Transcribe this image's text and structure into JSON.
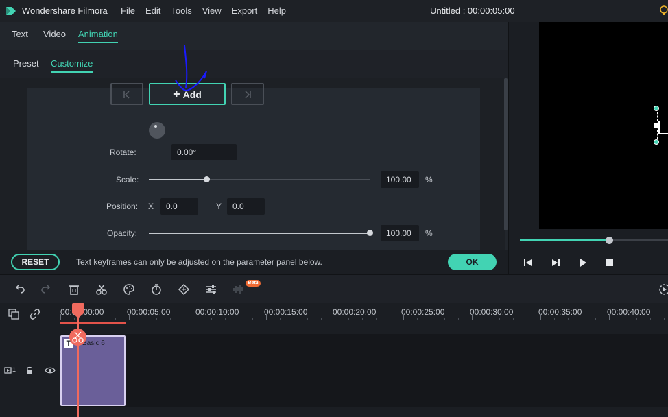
{
  "titlebar": {
    "app_name": "Wondershare Filmora",
    "menu": [
      "File",
      "Edit",
      "Tools",
      "View",
      "Export",
      "Help"
    ],
    "doc_title": "Untitled : 00:00:05:00"
  },
  "tabs": {
    "text": "Text",
    "video": "Video",
    "animation": "Animation"
  },
  "subtabs": {
    "preset": "Preset",
    "customize": "Customize"
  },
  "keyframes": {
    "add_label": "Add"
  },
  "params": {
    "rotate_label": "Rotate:",
    "rotate_value": "0.00°",
    "scale_label": "Scale:",
    "scale_value": "100.00",
    "scale_level": 0.26,
    "scale_unit": "%",
    "position_label": "Position:",
    "x_label": "X",
    "x_value": "0.0",
    "y_label": "Y",
    "y_value": "0.0",
    "opacity_label": "Opacity:",
    "opacity_value": "100.00",
    "opacity_level": 1.0,
    "opacity_unit": "%"
  },
  "footer": {
    "reset_label": "RESET",
    "hint": "Text keyframes can only be adjusted on the parameter panel below.",
    "ok_label": "OK"
  },
  "preview": {
    "progress": 0.6
  },
  "toolbar": {
    "beta_label": "Beta"
  },
  "timeline": {
    "ruler": [
      "00:00:00:00",
      "00:00:05:00",
      "00:00:10:00",
      "00:00:15:00",
      "00:00:20:00",
      "00:00:25:00",
      "00:00:30:00",
      "00:00:35:00",
      "00:00:40:00"
    ],
    "clip_name": "Basic 6",
    "clip_icon": "T",
    "track_number": "1"
  },
  "colors": {
    "accent": "#42d3b3",
    "playhead": "#f06a5e",
    "clip": "#6a5f99",
    "beta": "#ef6b34"
  }
}
